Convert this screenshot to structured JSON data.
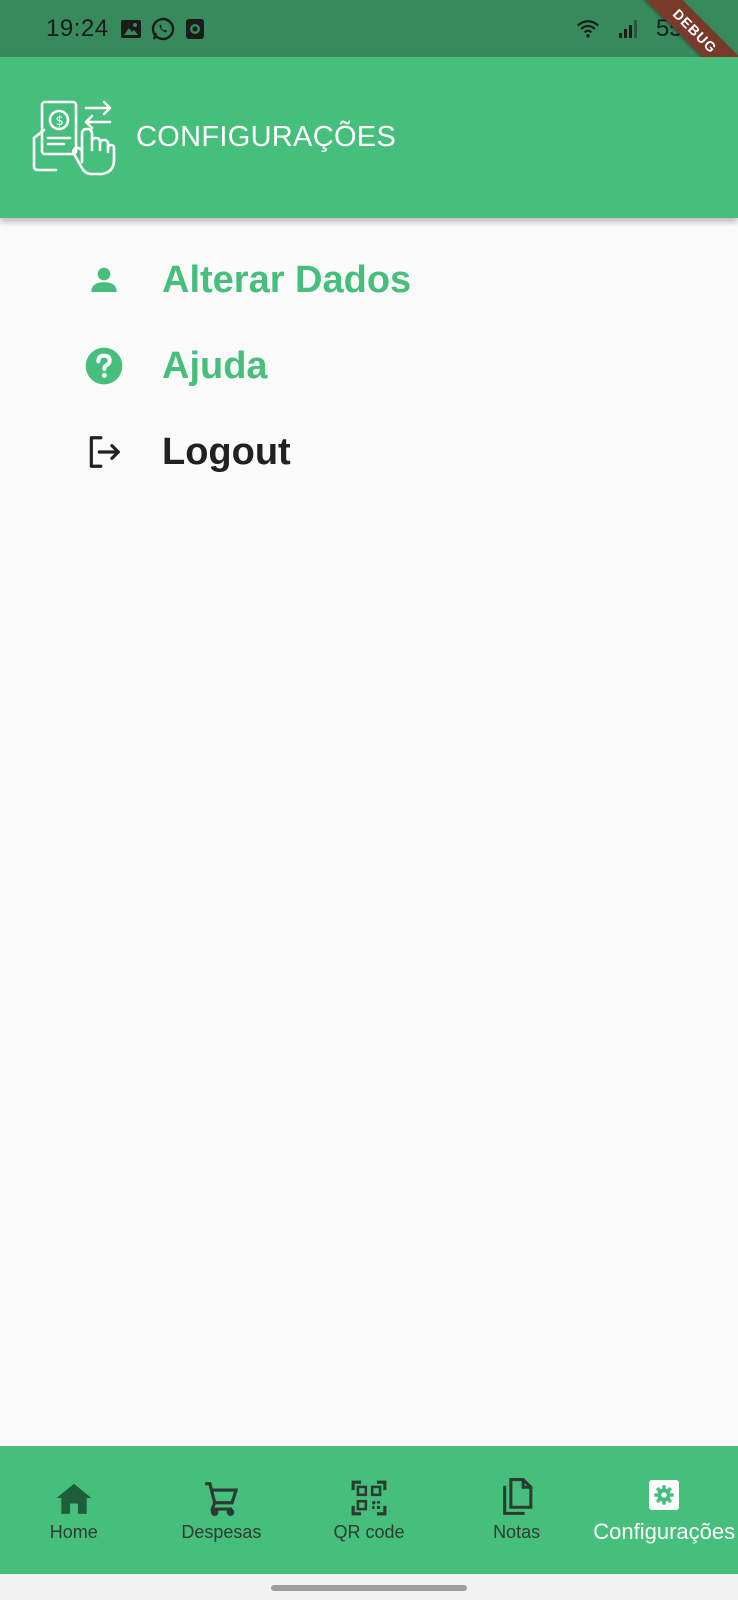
{
  "status_bar": {
    "time": "19:24",
    "battery": "55%",
    "icons": [
      "image-icon",
      "whatsapp-icon",
      "media-icon",
      "wifi-icon",
      "signal-icon"
    ]
  },
  "debug_banner": "DEBUG",
  "app_bar": {
    "title": "CONFIGURAÇÕES",
    "logo": "payment-hand-logo"
  },
  "menu": {
    "items": [
      {
        "label": "Alterar Dados",
        "icon": "person-icon",
        "color": "#46bf7c"
      },
      {
        "label": "Ajuda",
        "icon": "help-icon",
        "color": "#46bf7c"
      },
      {
        "label": "Logout",
        "icon": "logout-icon",
        "color": "#212121"
      }
    ]
  },
  "bottom_nav": {
    "items": [
      {
        "label": "Home",
        "icon": "home-icon"
      },
      {
        "label": "Despesas",
        "icon": "cart-icon"
      },
      {
        "label": "QR code",
        "icon": "qr-code-icon"
      },
      {
        "label": "Notas",
        "icon": "documents-icon"
      },
      {
        "label": "Configurações",
        "icon": "settings-icon",
        "active": true
      }
    ]
  },
  "colors": {
    "primary": "#46bf7c",
    "status_bar": "#368a5c",
    "background": "#fafafa",
    "text_dark": "#212121"
  }
}
